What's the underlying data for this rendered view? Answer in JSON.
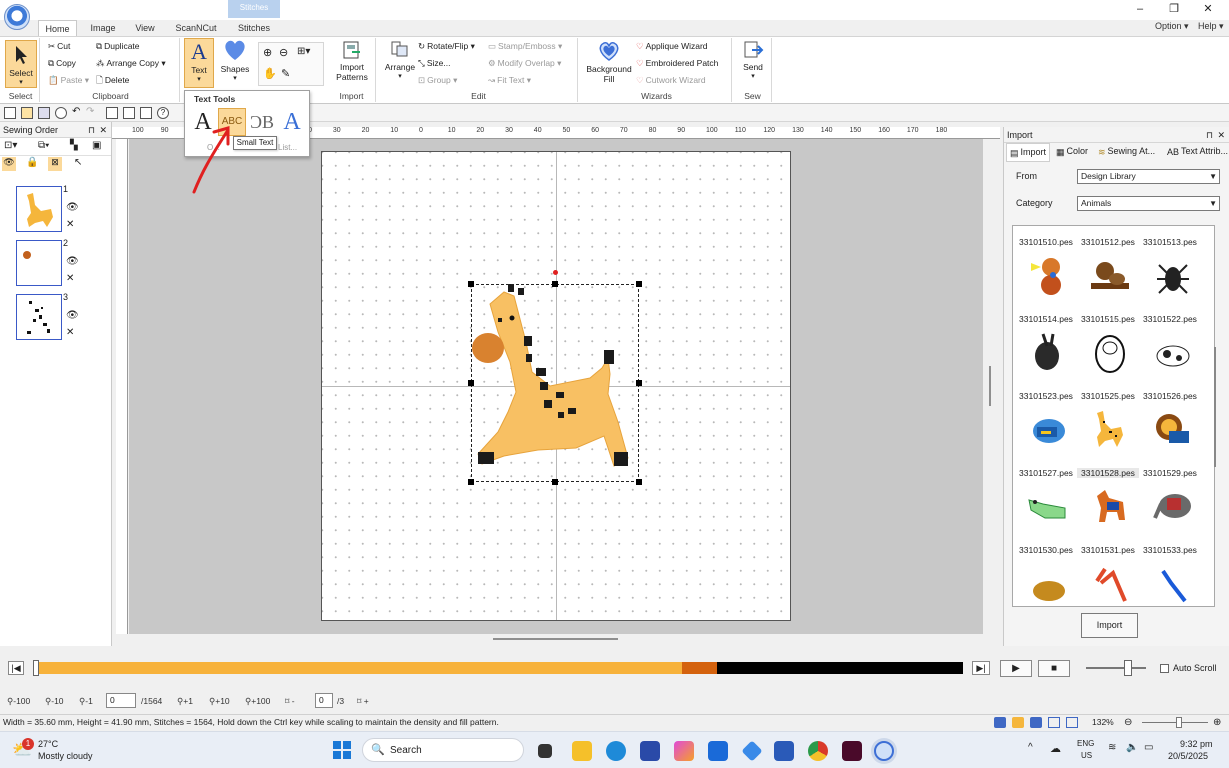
{
  "app": {
    "context_tab": "Stitches",
    "tabs": [
      "Home",
      "Image",
      "View",
      "ScanNCut",
      "Stitches"
    ],
    "option_menu": "Option",
    "help_menu": "Help"
  },
  "ribbon": {
    "select_group": {
      "select_label": "Select",
      "group_label": "Select"
    },
    "clipboard": {
      "cut": "Cut",
      "copy": "Copy",
      "paste": "Paste",
      "duplicate": "Duplicate",
      "arrange_copy": "Arrange Copy",
      "delete": "Delete",
      "group_label": "Clipboard"
    },
    "text_label": "Text",
    "shapes_label": "Shapes",
    "import_group": {
      "import_patterns": "Import\nPatterns",
      "group_label": "Import"
    },
    "edit": {
      "arrange": "Arrange",
      "rotate_flip": "Rotate/Flip",
      "size": "Size...",
      "group": "Group",
      "stamp_emboss": "Stamp/Emboss",
      "modify_overlap": "Modify Overlap",
      "fit_text": "Fit Text",
      "group_label": "Edit"
    },
    "wizards": {
      "background_fill": "Background\nFill",
      "applique": "Applique Wizard",
      "embroidered_patch": "Embroidered Patch",
      "cutwork": "Cutwork Wizard",
      "group_label": "Wizards"
    },
    "sew": {
      "send": "Send",
      "group_label": "Sew"
    }
  },
  "text_tools_popup": {
    "title": "Text Tools",
    "behind_text": "O...",
    "behind_list": "List...",
    "tooltip": "Small Text"
  },
  "sewing_order": {
    "title": "Sewing Order",
    "items": [
      {
        "num": "1"
      },
      {
        "num": "2"
      },
      {
        "num": "3"
      }
    ]
  },
  "ruler": {
    "top_ticks": [
      "100",
      "90",
      "80",
      "70",
      "60",
      "50",
      "40",
      "30",
      "20",
      "10",
      "0",
      "10",
      "20",
      "30",
      "40",
      "50",
      "60",
      "70",
      "80",
      "90",
      "100",
      "110",
      "120",
      "130",
      "140",
      "150",
      "160",
      "170",
      "180"
    ]
  },
  "import_panel": {
    "title": "Import",
    "tabs": [
      "Import",
      "Color",
      "Sewing At...",
      "Text Attrib..."
    ],
    "from_label": "From",
    "from_value": "Design Library",
    "category_label": "Category",
    "category_value": "Animals",
    "files": [
      "33101510.pes",
      "33101512.pes",
      "33101513.pes",
      "33101514.pes",
      "33101515.pes",
      "33101522.pes",
      "33101523.pes",
      "33101525.pes",
      "33101526.pes",
      "33101527.pes",
      "33101528.pes",
      "33101529.pes",
      "33101530.pes",
      "33101531.pes",
      "33101533.pes"
    ],
    "import_button": "Import"
  },
  "playback": {
    "auto_scroll": "Auto Scroll"
  },
  "nav": {
    "b1": "-100",
    "b2": "-10",
    "b3": "-1",
    "stitch_value": "0",
    "stitch_total": "/1564",
    "b4": "+1",
    "b5": "+10",
    "b6": "+100",
    "color_value": "0",
    "color_total": "/3"
  },
  "status": {
    "message": "Width = 35.60 mm, Height = 41.90 mm, Stitches = 1564, Hold down the Ctrl key while scaling to maintain the density and fill pattern.",
    "zoom": "132%"
  },
  "taskbar": {
    "temp": "27°C",
    "weather": "Mostly cloudy",
    "search": "Search",
    "lang": "ENG",
    "region": "US",
    "time": "9:32 pm",
    "date": "20/5/2025",
    "badge": "1"
  },
  "colors": {
    "accent": "#f7b23b",
    "selection": "#3a59c7",
    "progress_dark": "#d4620e"
  }
}
